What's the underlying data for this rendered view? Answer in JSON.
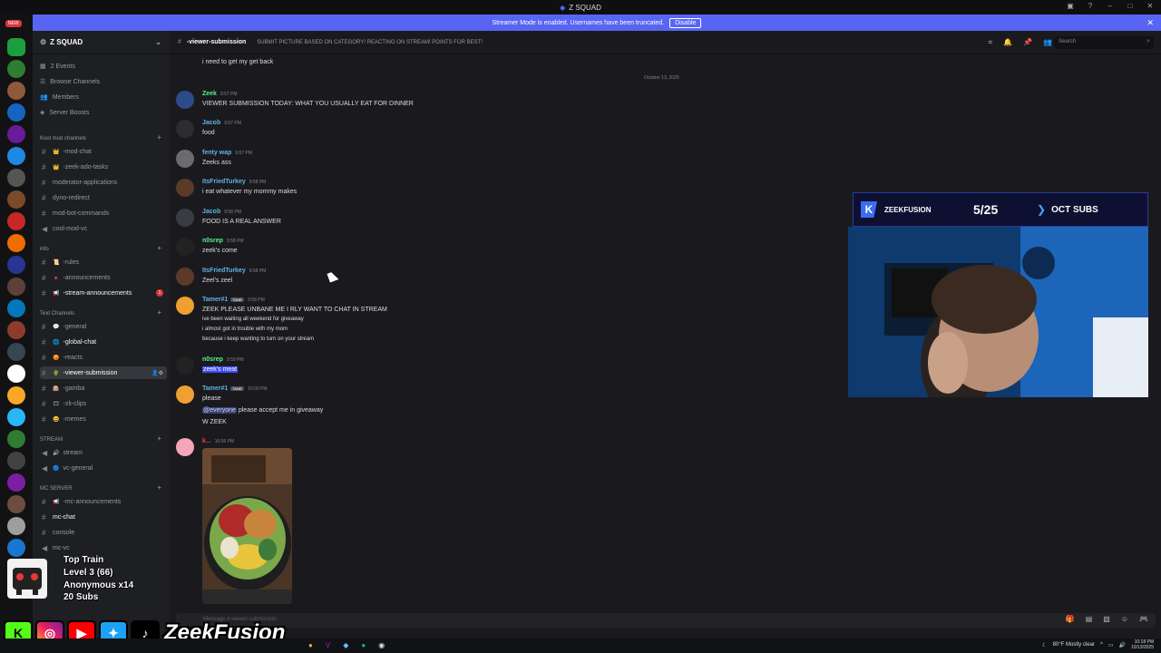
{
  "window": {
    "title": "Z SQUAD"
  },
  "banner": {
    "text": "Streamer Mode is enabled. Usernames have been truncated.",
    "disable_label": "Disable"
  },
  "rail": {
    "new_label": "NEW"
  },
  "sidebar": {
    "server_name": "Z SQUAD",
    "top_items": [
      {
        "label": "2 Events",
        "icon": "calendar-icon"
      },
      {
        "label": "Browse Channels",
        "icon": "browse-icon"
      },
      {
        "label": "Members",
        "icon": "members-icon"
      },
      {
        "label": "Server Boosts",
        "icon": "boost-icon"
      }
    ],
    "categories": {
      "mod": "Kool mod channels",
      "info": "info",
      "text": "Text Channels",
      "stream": "STREAM",
      "mc": "MC SERVER"
    },
    "mod_channels": [
      {
        "label": "-mod-chat",
        "prefix": "👑"
      },
      {
        "label": "-zeek-ado-tasks",
        "prefix": "👑"
      },
      {
        "label": "moderator-applications",
        "prefix": ""
      },
      {
        "label": "dyno-redirect",
        "prefix": ""
      },
      {
        "label": "mod-bot-commands",
        "prefix": ""
      },
      {
        "label": "cool-mod-vc",
        "prefix": ""
      }
    ],
    "info_channels": [
      {
        "label": "-rules",
        "prefix": "📜"
      },
      {
        "label": "-announcements",
        "prefix": "🔺"
      },
      {
        "label": "-stream-announcements",
        "prefix": "📢",
        "mention": "1"
      }
    ],
    "text_channels": [
      {
        "label": "-general",
        "prefix": "💬"
      },
      {
        "label": "-global-chat",
        "prefix": "🌐"
      },
      {
        "label": "-reacts",
        "prefix": "😡"
      },
      {
        "label": "-viewer-submission",
        "prefix": "🌵"
      },
      {
        "label": "-gamba",
        "prefix": "🎰"
      },
      {
        "label": "-zk-clips",
        "prefix": "🎞"
      },
      {
        "label": "-memes",
        "prefix": "😆"
      }
    ],
    "stream_channels": [
      {
        "label": "stream",
        "prefix": "🔊"
      },
      {
        "label": "vc-general",
        "prefix": "🔵"
      }
    ],
    "mc_channels": [
      {
        "label": "-mc-announcements",
        "prefix": "📢"
      },
      {
        "label": "mc-chat",
        "prefix": ""
      },
      {
        "label": "console",
        "prefix": ""
      },
      {
        "label": "mc-vc",
        "prefix": ""
      }
    ]
  },
  "header": {
    "channel": "-viewer-submission",
    "topic": "SUBMIT PICTURE BASED ON CATEGORY! REACTING ON STREAM! POINTS FOR BEST!",
    "search_placeholder": "Search"
  },
  "messages": {
    "top_line": "i need to get my get back",
    "date_divider": "October 13, 2025",
    "items": [
      {
        "user": "Zeek",
        "color": "#57f287",
        "time": "9:57 PM",
        "lines": [
          "VIEWER SUBMISSION TODAY: WHAT YOU USUALLY EAT FOR DINNER"
        ]
      },
      {
        "user": "Jacob",
        "color": "#5fb3e6",
        "time": "9:57 PM",
        "lines": [
          "food"
        ]
      },
      {
        "user": "fenty wap",
        "color": "#5fb3e6",
        "time": "9:57 PM",
        "lines": [
          "Zeeks ass"
        ]
      },
      {
        "user": "ItsFriedTurkey",
        "color": "#5fb3e6",
        "time": "9:58 PM",
        "lines": [
          "i eat whatever my mommy makes"
        ]
      },
      {
        "user": "Jacob",
        "color": "#5fb3e6",
        "time": "9:58 PM",
        "lines": [
          "FOOD IS A REAL ANSWER"
        ]
      },
      {
        "user": "n0srep",
        "color": "#57f287",
        "time": "9:58 PM",
        "lines": [
          "zeek's come"
        ]
      },
      {
        "user": "ItsFriedTurkey",
        "color": "#5fb3e6",
        "time": "9:58 PM",
        "lines": [
          "Zeel's zeel"
        ]
      },
      {
        "user": "Tamer#1",
        "color": "#5fb3e6",
        "tag": "TAME",
        "time": "9:58 PM",
        "lines": [
          "ZEEK PLEASE UNBANE ME I RLY WANT TO CHAT IN STREAM",
          "ive been waiting all weekend for giveaway",
          "i almost got in trouble with my mom",
          "because i keep wanting to turn on your stream"
        ]
      },
      {
        "user": "n0srep",
        "color": "#57f287",
        "time": "9:59 PM",
        "lines": [
          "zeek's meat"
        ]
      },
      {
        "user": "Tamer#1",
        "color": "#5fb3e6",
        "tag": "TAME",
        "time": "10:00 PM",
        "lines": [
          "please",
          "please accept me in giveaway",
          "W ZEEK"
        ],
        "mention": "@everyone"
      },
      {
        "user": "k...",
        "color": "#f23f43",
        "time": "10:06 PM",
        "lines": []
      }
    ]
  },
  "composer": {
    "placeholder": "Message #-viewer-submission"
  },
  "overlay": {
    "name": "ZEEKFUSION",
    "sub_count": "5/25",
    "goal": "OCT SUBS"
  },
  "train": {
    "title": "Top Train",
    "level": "Level 3 (66)",
    "anon": "Anonymous x14",
    "subs": "20 Subs"
  },
  "social": {
    "handle": "ZeekFusion"
  },
  "taskbar": {
    "weather": "80°F  Mostly clear",
    "time": "10:18 PM",
    "date": "10/13/2025"
  },
  "colors": {
    "accent": "#5865f2",
    "alert": "#da373c",
    "background": "#1a1a1e"
  }
}
